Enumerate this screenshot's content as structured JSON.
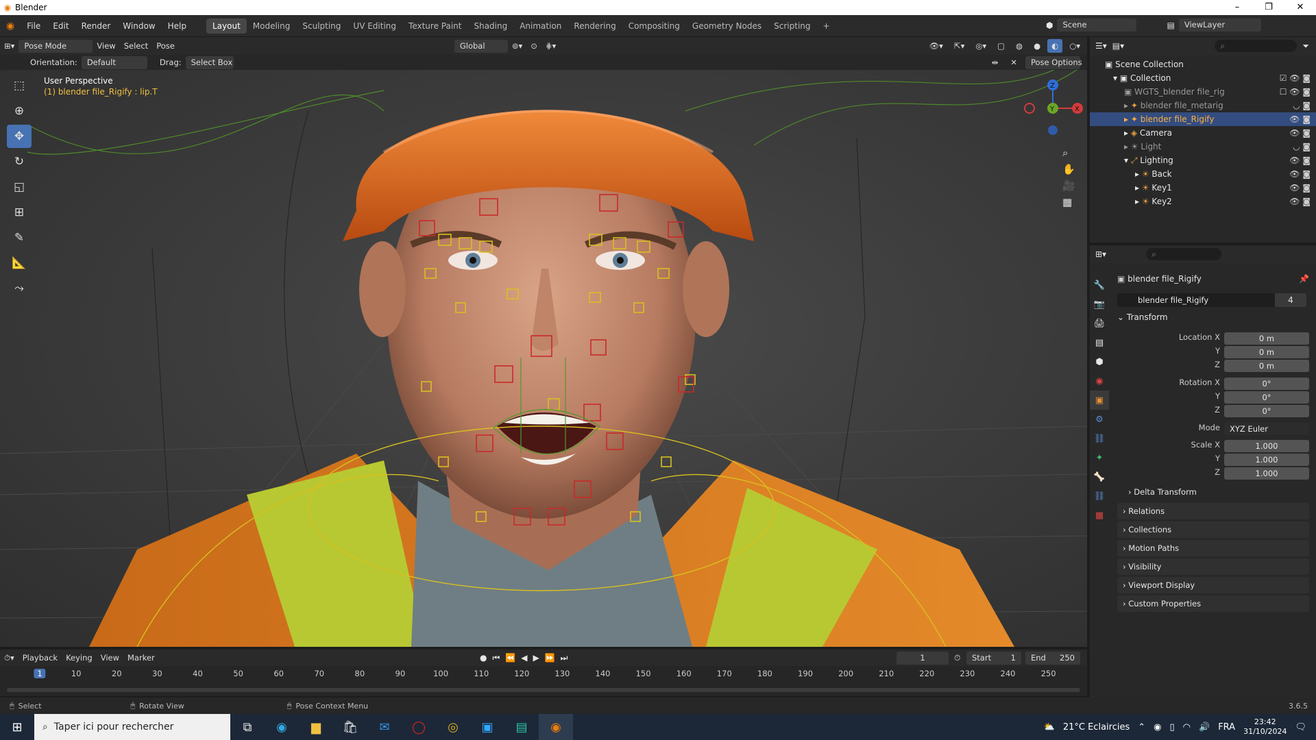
{
  "window": {
    "title": "Blender",
    "controls": [
      "–",
      "❐",
      "✕"
    ]
  },
  "menu": {
    "items": [
      "File",
      "Edit",
      "Render",
      "Window",
      "Help"
    ]
  },
  "workspaces": {
    "tabs": [
      "Layout",
      "Modeling",
      "Sculpting",
      "UV Editing",
      "Texture Paint",
      "Shading",
      "Animation",
      "Rendering",
      "Compositing",
      "Geometry Nodes",
      "Scripting"
    ],
    "active": "Layout",
    "add": "+"
  },
  "scene": {
    "name": "Scene",
    "viewlayer": "ViewLayer"
  },
  "viewport_header": {
    "mode": "Pose Mode",
    "menus": [
      "View",
      "Select",
      "Pose"
    ],
    "transform": "Global",
    "pose_options": "Pose Options"
  },
  "viewport_tool": {
    "orientation_label": "Orientation:",
    "orientation": "Default",
    "drag_label": "Drag:",
    "drag": "Select Box"
  },
  "viewport": {
    "view_name": "User Perspective",
    "context": "(1) blender file_Rigify : lip.T"
  },
  "outliner": {
    "root": "Scene Collection",
    "rows": [
      {
        "name": "Collection",
        "indent": 1
      },
      {
        "name": "WGTS_blender file_rig",
        "indent": 2
      },
      {
        "name": "blender file_metarig",
        "indent": 2
      },
      {
        "name": "blender file_Rigify",
        "indent": 2,
        "selected": true
      },
      {
        "name": "Camera",
        "indent": 2
      },
      {
        "name": "Light",
        "indent": 2
      },
      {
        "name": "Lighting",
        "indent": 2
      },
      {
        "name": "Back",
        "indent": 3
      },
      {
        "name": "Key1",
        "indent": 3
      },
      {
        "name": "Key2",
        "indent": 3
      }
    ]
  },
  "properties": {
    "object_name": "blender file_Rigify",
    "data_name": "blender file_Rigify",
    "users": "4",
    "transform_title": "Transform",
    "location_label": "Location X",
    "rotation_label": "Rotation X",
    "scale_label": "Scale X",
    "y": "Y",
    "z": "Z",
    "location": [
      "0 m",
      "0 m",
      "0 m"
    ],
    "rotation": [
      "0°",
      "0°",
      "0°"
    ],
    "mode_label": "Mode",
    "mode": "XYZ Euler",
    "scale": [
      "1.000",
      "1.000",
      "1.000"
    ],
    "sections": [
      "Delta Transform",
      "Relations",
      "Collections",
      "Motion Paths",
      "Visibility",
      "Viewport Display",
      "Custom Properties"
    ]
  },
  "timeline": {
    "menus": [
      "Playback",
      "Keying",
      "View",
      "Marker"
    ],
    "current_frame": "1",
    "start_label": "Start",
    "start": "1",
    "end_label": "End",
    "end": "250",
    "ticks": [
      "1",
      "10",
      "20",
      "30",
      "40",
      "50",
      "60",
      "70",
      "80",
      "90",
      "100",
      "110",
      "120",
      "130",
      "140",
      "150",
      "160",
      "170",
      "180",
      "190",
      "200",
      "210",
      "220",
      "230",
      "240",
      "250"
    ]
  },
  "status": {
    "select": "Select",
    "rotate": "Rotate View",
    "context": "Pose Context Menu",
    "version": "3.6.5"
  },
  "taskbar": {
    "search": "Taper ici pour rechercher",
    "weather": "21°C  Eclaircies",
    "lang": "FRA",
    "time": "23:42",
    "date": "31/10/2024"
  }
}
